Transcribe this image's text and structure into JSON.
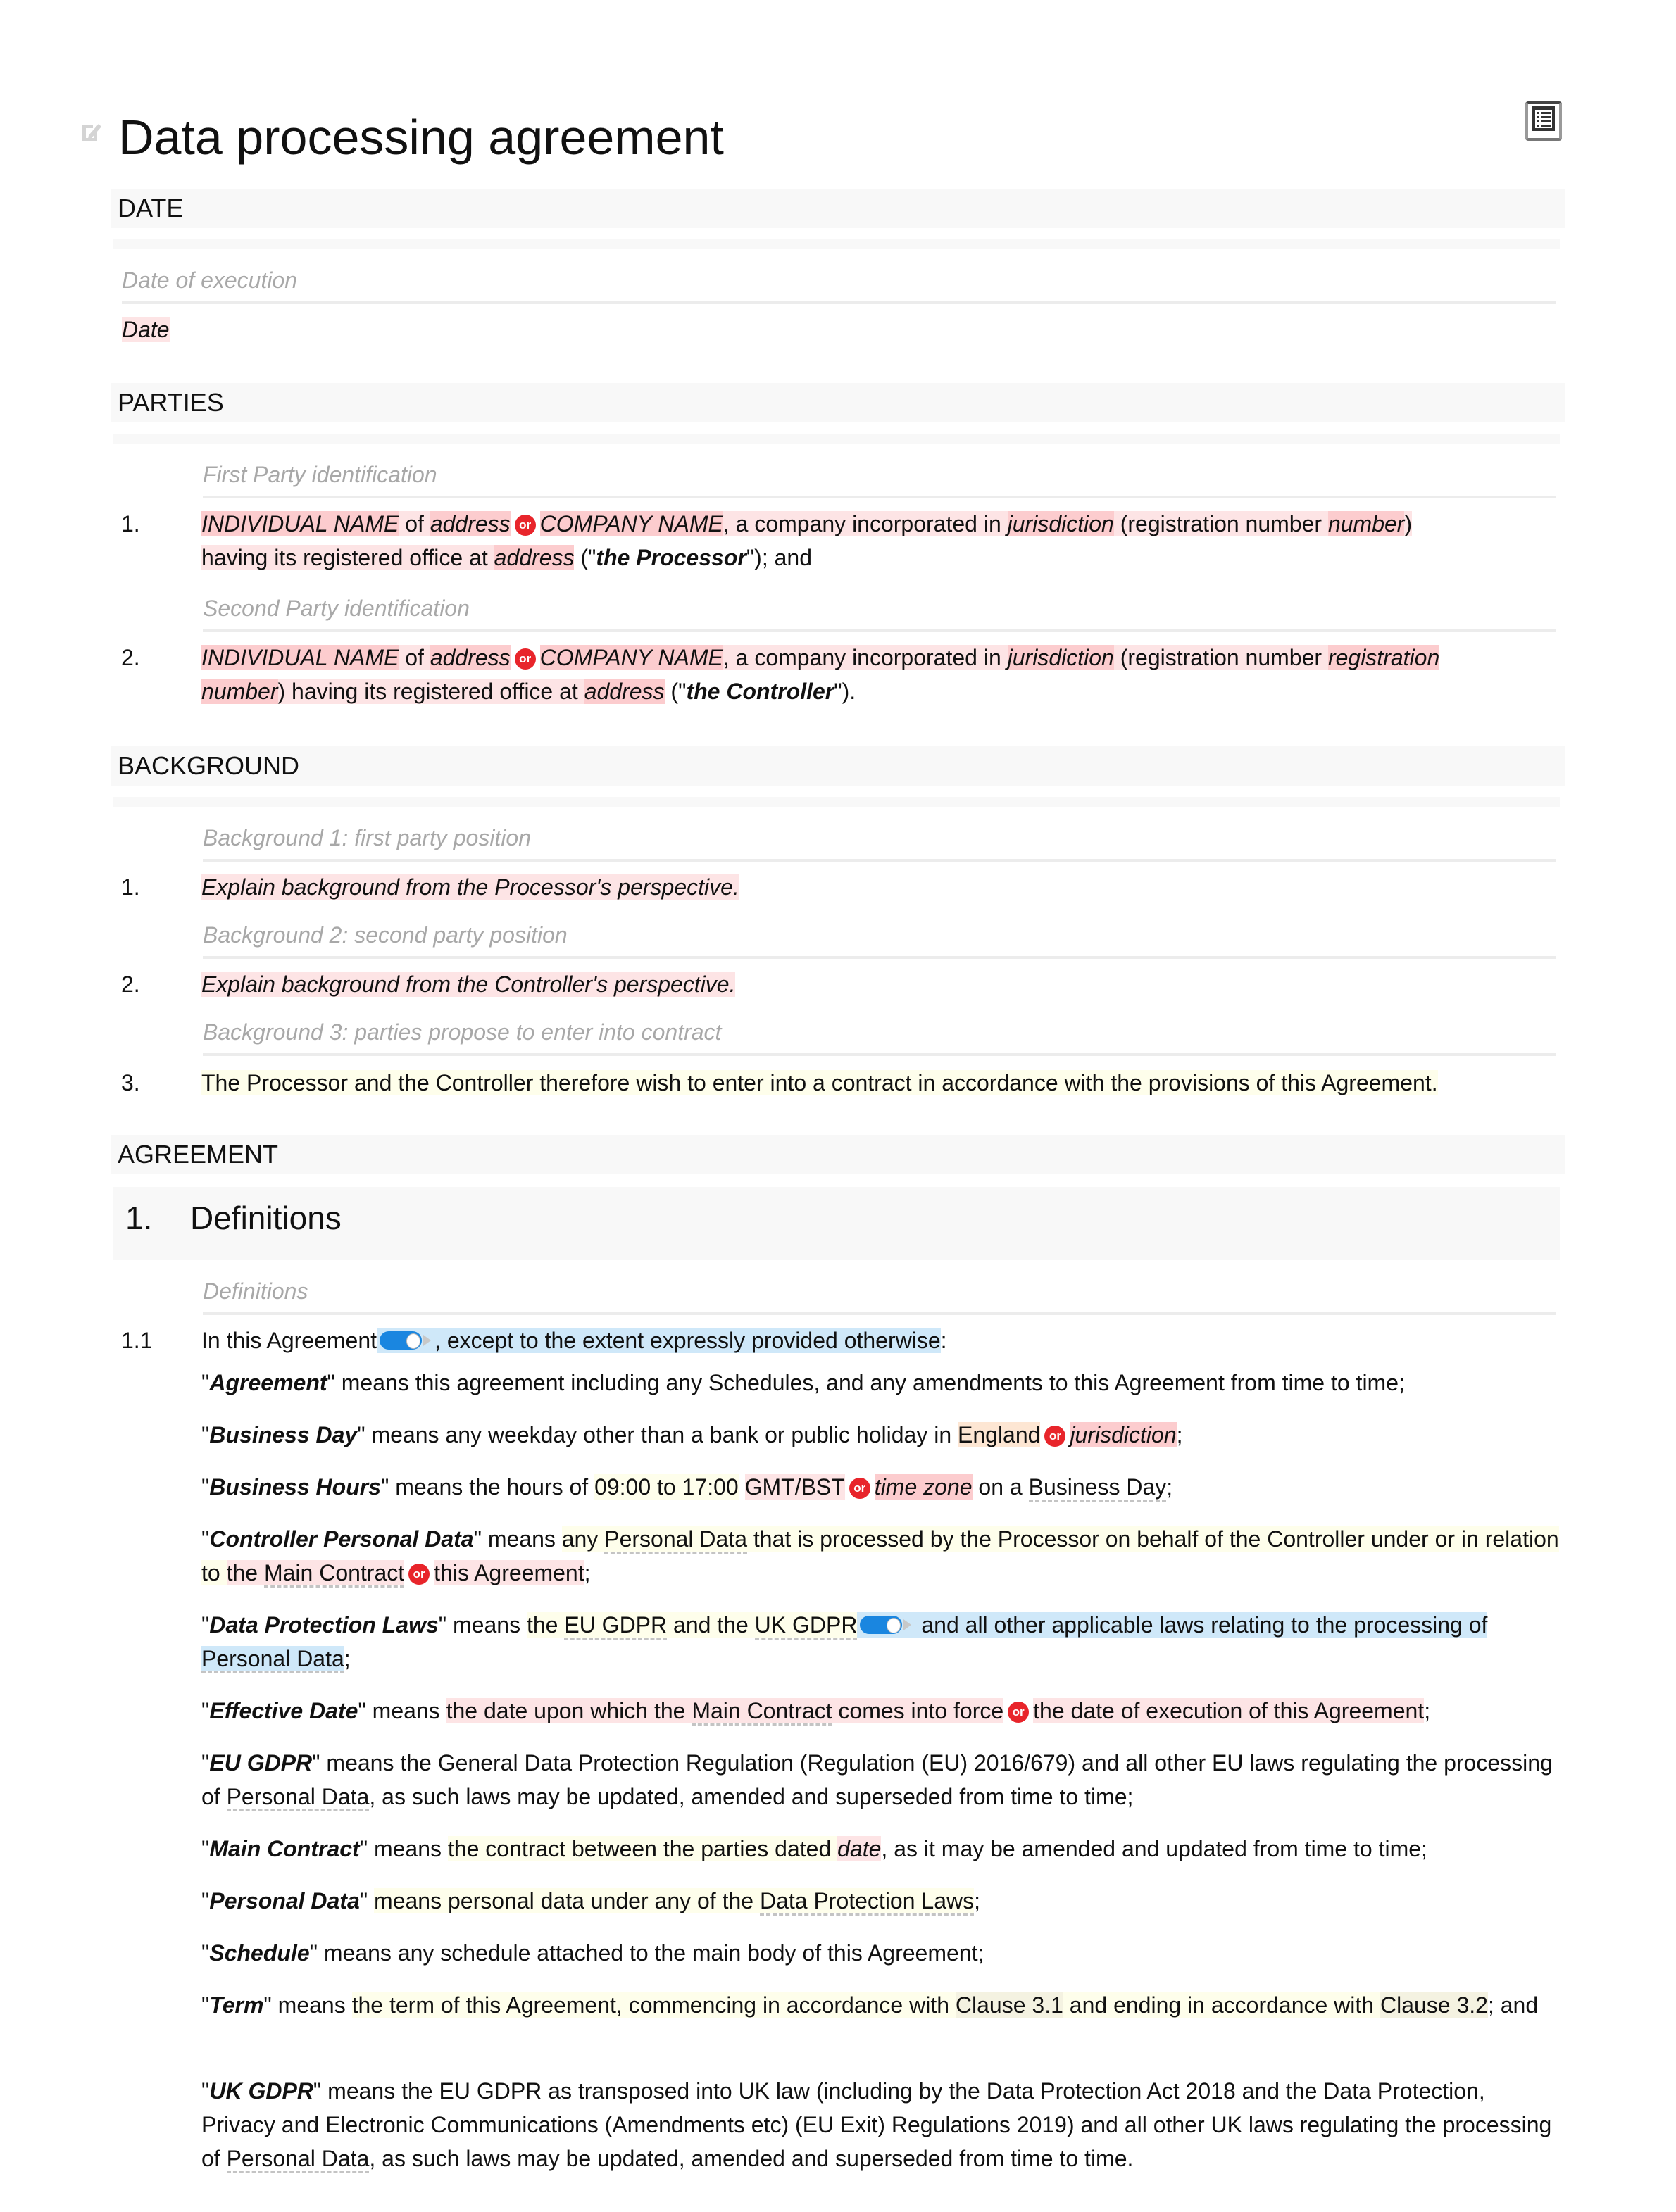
{
  "document": {
    "title": "Data processing agreement",
    "icons": {
      "edit": "edit-pencil-icon",
      "toc": "table-of-contents-icon"
    }
  },
  "colors": {
    "placeholder_highlight": "#fcccce",
    "option_highlight": "#fde4e5",
    "optional_highlight": "#fefeeb",
    "default_option_highlight": "#fde6d3",
    "toggle_highlight": "#cfe8f9",
    "or_badge": "#e8252b",
    "toggle_track": "#1a86e0"
  },
  "sections": {
    "date": {
      "header": "DATE",
      "hint": "Date of execution",
      "value": "Date"
    },
    "parties": {
      "header": "PARTIES",
      "items": [
        {
          "hint": "First Party identification",
          "number": "1.",
          "individual_name": "INDIVIDUAL NAME",
          "of": " of ",
          "address1": "address",
          "or": "or",
          "company_name": "COMPANY NAME",
          "mid": ", a company incorporated in ",
          "jurisdiction": "jurisdiction",
          "reg_label": " (registration number ",
          "reg_value": "number",
          "reg_close": ")",
          "line2_pre": "having its registered office at ",
          "address2": "address",
          "open_quote": " (\"",
          "role": "the Processor",
          "tail": "\"); and"
        },
        {
          "hint": "Second Party identification",
          "number": "2.",
          "individual_name": "INDIVIDUAL NAME",
          "of": " of ",
          "address1": "address",
          "or": "or",
          "company_name": "COMPANY NAME",
          "mid": ", a company incorporated in ",
          "jurisdiction": "jurisdiction",
          "reg_label": " (registration number ",
          "reg_value_1": "registration",
          "reg_value_2": "number",
          "line2_pre": ") having its registered office at ",
          "address2": "address",
          "open_quote": " (\"",
          "role": "the Controller",
          "tail": "\")."
        }
      ]
    },
    "background": {
      "header": "BACKGROUND",
      "items": [
        {
          "hint": "Background 1: first party position",
          "number": "1.",
          "text": "Explain background from the Processor's perspective."
        },
        {
          "hint": "Background 2: second party position",
          "number": "2.",
          "text": "Explain background from the Controller's perspective."
        },
        {
          "hint": "Background 3: parties propose to enter into contract",
          "number": "3.",
          "text": "The Processor and the Controller therefore wish to enter into a contract in accordance with the provisions of this Agreement."
        }
      ]
    },
    "agreement": {
      "header": "AGREEMENT",
      "clause": {
        "number": "1.",
        "title": "Definitions"
      },
      "hint": "Definitions",
      "intro": {
        "number": "1.1",
        "pre": "In this Agreement",
        "post": ", except to the extent expressly provided otherwise",
        "colon": ":"
      },
      "definitions": {
        "agreement": {
          "term": "Agreement",
          "text": "\" means this agreement including any Schedules, and any amendments to this Agreement from time to time;"
        },
        "business_day": {
          "term": "Business Day",
          "pre": "\" means any weekday other than a bank or public holiday in ",
          "opt1": "England",
          "or": "or",
          "opt2": "jurisdiction",
          "tail": ";"
        },
        "business_hours": {
          "term": "Business Hours",
          "pre": "\" means the hours of ",
          "hours": "09:00 to 17:00",
          "opt1": "GMT/BST",
          "or": "or",
          "opt2": "time zone",
          "mid": " on a ",
          "link": "Business Day",
          "tail": ";"
        },
        "controller_personal_data": {
          "term": "Controller Personal Data",
          "pre": "\" means ",
          "s1": "any ",
          "link": "Personal Data",
          "s2": " that is processed by the Processor on behalf of the Controller under or in relation to ",
          "opt1_a": "the ",
          "opt1_link": "Main Contract",
          "or": "or",
          "opt2": "this Agreement",
          "tail": ";"
        },
        "data_protection_laws": {
          "term": "Data Protection Laws",
          "pre": "\" means ",
          "s1": "the ",
          "link1": "EU GDPR",
          "s2": " and the ",
          "link2": "UK GDPR",
          "s3": " and all other applicable laws relating to the processing ",
          "s4": "of ",
          "link3": "Personal Data",
          "tail": ";"
        },
        "effective_date": {
          "term": "Effective Date",
          "pre": "\" means ",
          "opt1_a": "the date upon which the ",
          "opt1_link": "Main Contract",
          "opt1_b": " comes into force",
          "or": "or",
          "opt2": "the date of execution of this Agreement",
          "tail": ";"
        },
        "eu_gdpr": {
          "term": "EU GDPR",
          "pre": "\" means the General Data Protection Regulation (Regulation (EU) 2016/679) and all other EU laws regulating the processing of ",
          "link": "Personal Data",
          "tail": ", as such laws may be updated, amended and superseded from time to time;"
        },
        "main_contract": {
          "term": "Main Contract",
          "pre": "\" means ",
          "s1": "the contract between the parties dated ",
          "date": "date",
          "tail": ", as it may be amended and updated from time to time;"
        },
        "personal_data": {
          "term": "Personal Data",
          "pre": "\" ",
          "s1": "means personal data under any of the ",
          "link": "Data Protection Laws",
          "tail": ";"
        },
        "schedule": {
          "term": "Schedule",
          "text": "\" means any schedule attached to the main body of this Agreement;"
        },
        "term": {
          "term": "Term",
          "pre": "\" means ",
          "s1": "the term of this Agreement, commencing in accordance with ",
          "clause1": "Clause 3.1",
          "s2": " and ending in accordance with ",
          "clause2": "Clause 3.2",
          "tail": "; and"
        },
        "uk_gdpr": {
          "term": "UK GDPR",
          "pre": "\" means the EU GDPR as transposed into UK law (including by the Data Protection Act 2018 and the Data Protection, Privacy and Electronic Communications (Amendments etc) (EU Exit) Regulations 2019) and all other UK laws regulating the processing of ",
          "link": "Personal Data",
          "tail": ", as such laws may be updated, amended and superseded from time to time."
        }
      },
      "quote_open": "\""
    }
  }
}
